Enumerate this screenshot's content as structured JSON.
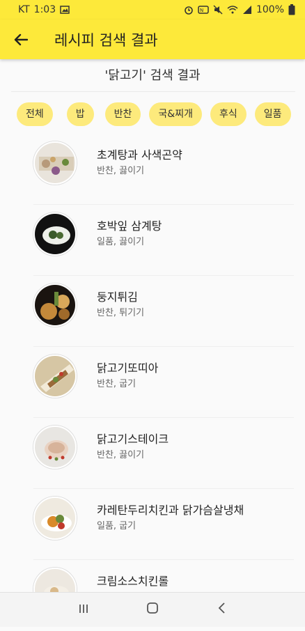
{
  "status": {
    "carrier": "KT",
    "time": "1:03",
    "battery": "100%"
  },
  "appbar": {
    "title": "레시피 검색 결과",
    "back_icon": "arrow-left-icon"
  },
  "result_header": "'닭고기' 검색 결과",
  "chips": [
    "전체",
    "밥",
    "반찬",
    "국&찌개",
    "후식",
    "일품"
  ],
  "items": [
    {
      "title": "초계탕과 사색곤약",
      "sub": "반찬, 끓이기"
    },
    {
      "title": "호박잎 삼계탕",
      "sub": "일품, 끓이기"
    },
    {
      "title": "둥지튀김",
      "sub": "반찬, 튀기기"
    },
    {
      "title": "닭고기또띠아",
      "sub": "반찬, 굽기"
    },
    {
      "title": "닭고기스테이크",
      "sub": "반찬, 끓이기"
    },
    {
      "title": "카레탄두리치킨과 닭가슴살냉채",
      "sub": "일품, 굽기"
    },
    {
      "title": "크림소스치킨롤",
      "sub": ""
    }
  ],
  "navbar": {
    "recents": "|||",
    "home": "◯",
    "back": "‹"
  }
}
